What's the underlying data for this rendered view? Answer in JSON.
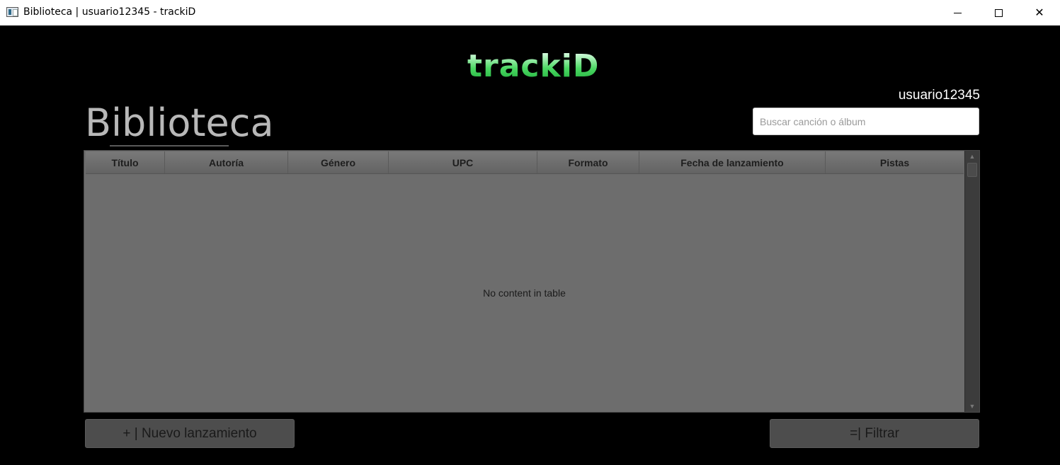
{
  "window": {
    "title": "Biblioteca | usuario12345 - trackiD",
    "controls": {
      "minimize": "minimize",
      "maximize": "maximize",
      "close": "✕"
    }
  },
  "header": {
    "logo": "trackiD",
    "username": "usuario12345"
  },
  "page": {
    "title": "Biblioteca"
  },
  "search": {
    "placeholder": "Buscar canción o álbum",
    "value": ""
  },
  "table": {
    "columns": [
      "Título",
      "Autoría",
      "Género",
      "UPC",
      "Formato",
      "Fecha de lanzamiento",
      "Pistas"
    ],
    "rows": [],
    "empty_message": "No content in table"
  },
  "actions": {
    "new_release": "+ | Nuevo lanzamiento",
    "filter": "=| Filtrar"
  },
  "colors": {
    "background": "#000000",
    "logo_accent": "#4cd964",
    "table_bg": "#6d6d6d",
    "button_bg": "#4d4d4d"
  }
}
